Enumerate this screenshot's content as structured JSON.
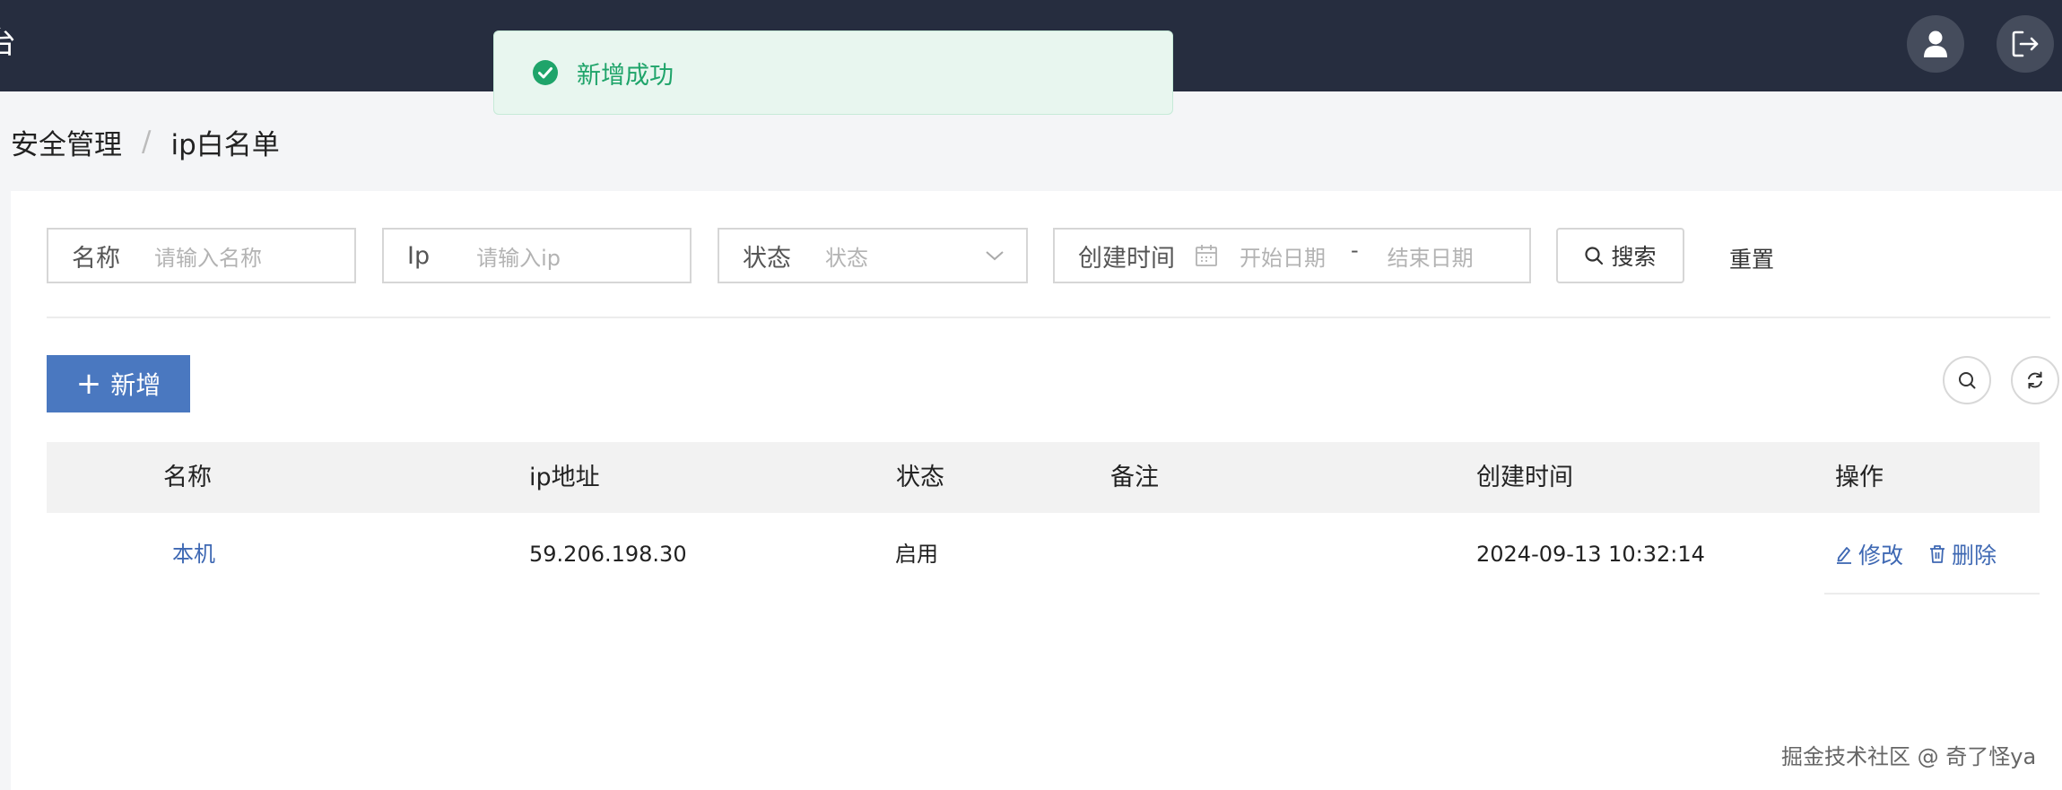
{
  "header": {
    "title_fragment": "台",
    "user_icon": "user-icon",
    "logout_icon": "logout-icon"
  },
  "toast": {
    "icon": "check-circle-icon",
    "message": "新增成功",
    "color": "#1fa46a"
  },
  "breadcrumb": {
    "items": [
      "安全管理",
      "ip白名单"
    ],
    "separator": "/"
  },
  "filters": {
    "name": {
      "label": "名称",
      "placeholder": "请输入名称"
    },
    "ip": {
      "label": "Ip",
      "placeholder": "请输入ip"
    },
    "status": {
      "label": "状态",
      "placeholder": "状态"
    },
    "created": {
      "label": "创建时间",
      "start_placeholder": "开始日期",
      "range_sep": "-",
      "end_placeholder": "结束日期"
    },
    "search_label": "搜索",
    "reset_label": "重置"
  },
  "toolbar": {
    "add_label": "新增",
    "accent": "#4a78c0"
  },
  "table": {
    "columns": [
      "名称",
      "ip地址",
      "状态",
      "备注",
      "创建时间",
      "操作"
    ],
    "rows": [
      {
        "name": "本机",
        "ip": "59.206.198.30",
        "status": "启用",
        "remark": "",
        "created": "2024-09-13 10:32:14",
        "actions": {
          "edit": "修改",
          "delete": "删除"
        }
      }
    ]
  },
  "watermark": "掘金技术社区 @ 奇了怪ya"
}
